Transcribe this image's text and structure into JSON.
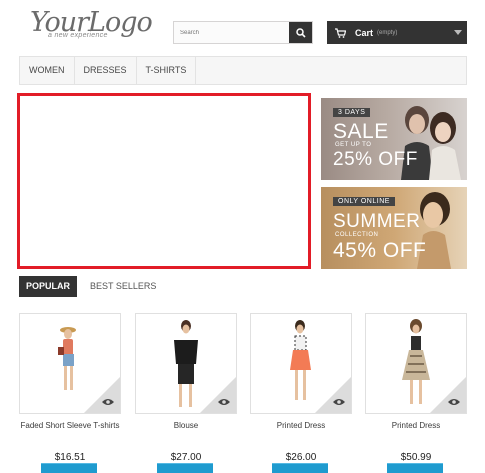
{
  "header": {
    "logo_main": "YourLogo",
    "logo_tagline": "a new experience",
    "search_placeholder": "Search",
    "cart_label": "Cart",
    "cart_status": "(empty)"
  },
  "menu": {
    "items": [
      {
        "label": "WOMEN"
      },
      {
        "label": "DRESSES"
      },
      {
        "label": "T-SHIRTS"
      }
    ]
  },
  "banners": [
    {
      "tag": "3 DAYS",
      "headline": "SALE",
      "sub": "GET UP TO",
      "offer": "25% OFF"
    },
    {
      "tag": "ONLY ONLINE",
      "headline": "SUMMER",
      "sub": "COLLECTION",
      "offer": "45% OFF"
    }
  ],
  "tabs": {
    "active": "POPULAR",
    "other": "BEST SELLERS"
  },
  "products": [
    {
      "name": "Faded Short Sleeve T-shirts",
      "price": "$16.51"
    },
    {
      "name": "Blouse",
      "price": "$27.00"
    },
    {
      "name": "Printed Dress",
      "price": "$26.00"
    },
    {
      "name": "Printed Dress",
      "price": "$50.99"
    }
  ],
  "colors": {
    "accent_red": "#e21c27",
    "dark": "#333333",
    "button_blue": "#1f9bcf"
  }
}
